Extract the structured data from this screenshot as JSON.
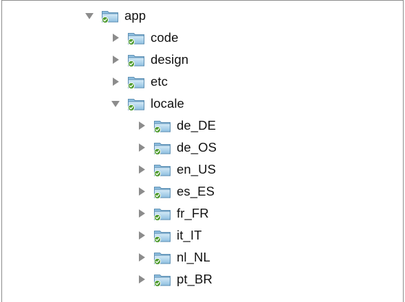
{
  "tree": {
    "nodes": [
      {
        "label": "app",
        "depth": 0,
        "expanded": true
      },
      {
        "label": "code",
        "depth": 1,
        "expanded": false
      },
      {
        "label": "design",
        "depth": 1,
        "expanded": false
      },
      {
        "label": "etc",
        "depth": 1,
        "expanded": false
      },
      {
        "label": "locale",
        "depth": 1,
        "expanded": true
      },
      {
        "label": "de_DE",
        "depth": 2,
        "expanded": false
      },
      {
        "label": "de_OS",
        "depth": 2,
        "expanded": false
      },
      {
        "label": "en_US",
        "depth": 2,
        "expanded": false
      },
      {
        "label": "es_ES",
        "depth": 2,
        "expanded": false
      },
      {
        "label": "fr_FR",
        "depth": 2,
        "expanded": false
      },
      {
        "label": "it_IT",
        "depth": 2,
        "expanded": false
      },
      {
        "label": "nl_NL",
        "depth": 2,
        "expanded": false
      },
      {
        "label": "pt_BR",
        "depth": 2,
        "expanded": false
      }
    ]
  },
  "icons": {
    "folder": "folder-checked-icon",
    "expanded": "triangle-down-icon",
    "collapsed": "triangle-right-icon"
  },
  "colors": {
    "disclosure": "#8c8c8c",
    "folder_light": "#d7ecf8",
    "folder_dark": "#8ebfe0",
    "folder_edge": "#5d8fb3",
    "check_badge": "#4f9b2f"
  }
}
